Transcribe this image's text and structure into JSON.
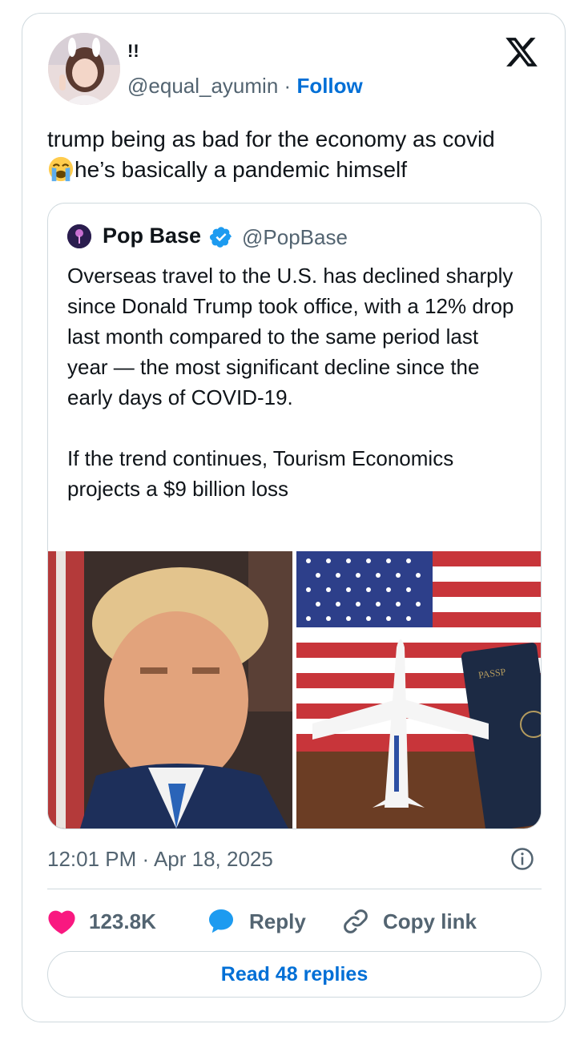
{
  "author": {
    "display_name": "!!",
    "handle": "@equal_ayumin",
    "separator": "·",
    "follow_label": "Follow"
  },
  "tweet": {
    "text_before_emoji": "trump being as bad for the economy as covid",
    "emoji": "loudly-crying-face",
    "text_after_emoji": "he’s basically a pandemic himself"
  },
  "quoted_tweet": {
    "display_name": "Pop Base",
    "handle": "@PopBase",
    "text": "Overseas travel to the U.S. has declined sharply since Donald Trump took office, with a 12% drop last month compared to the same period last year — the most significant decline since the early days of COVID-19.\n\nIf the trend continues, Tourism Economics projects a $9 billion loss",
    "media": [
      {
        "name": "portrait-photo"
      },
      {
        "name": "flag-airplane-passport-photo",
        "passport_text": "PASSP"
      }
    ]
  },
  "timestamp": "12:01 PM · Apr 18, 2025",
  "actions": {
    "like_count": "123.8K",
    "reply_label": "Reply",
    "copy_link_label": "Copy link"
  },
  "read_replies_label": "Read 48 replies",
  "colors": {
    "link_blue": "#006fd6",
    "like_pink": "#f91880",
    "reply_blue": "#1d9bf0",
    "muted": "#536471",
    "border": "#cfd9de"
  }
}
